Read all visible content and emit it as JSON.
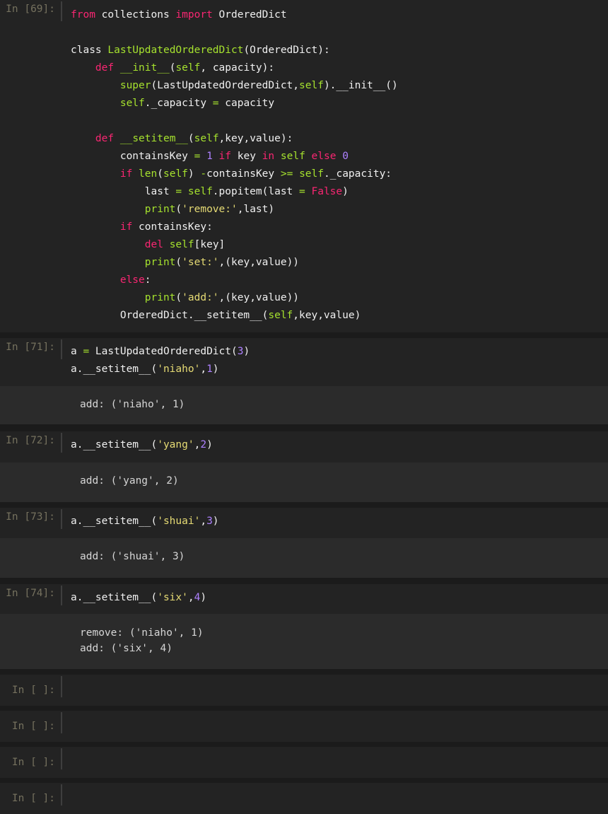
{
  "cells": [
    {
      "prompt": "In [69]:",
      "lines": [
        [
          [
            "kw",
            "from"
          ],
          [
            "plain",
            " collections "
          ],
          [
            "kw",
            "import"
          ],
          [
            "plain",
            " OrderedDict"
          ]
        ],
        [],
        [
          [
            "plain",
            "class "
          ],
          [
            "cls",
            "LastUpdatedOrderedDict"
          ],
          [
            "plain",
            "(OrderedDict):"
          ]
        ],
        [
          [
            "plain",
            "    "
          ],
          [
            "def",
            "def"
          ],
          [
            "plain",
            " "
          ],
          [
            "fn",
            "__init__"
          ],
          [
            "plain",
            "("
          ],
          [
            "self",
            "self"
          ],
          [
            "plain",
            ", capacity):"
          ]
        ],
        [
          [
            "plain",
            "        "
          ],
          [
            "self",
            "super"
          ],
          [
            "plain",
            "(LastUpdatedOrderedDict,"
          ],
          [
            "self",
            "self"
          ],
          [
            "plain",
            ").__init__()"
          ]
        ],
        [
          [
            "plain",
            "        "
          ],
          [
            "self",
            "self"
          ],
          [
            "plain",
            "._capacity "
          ],
          [
            "op",
            "="
          ],
          [
            "plain",
            " capacity"
          ]
        ],
        [],
        [
          [
            "plain",
            "    "
          ],
          [
            "def",
            "def"
          ],
          [
            "plain",
            " "
          ],
          [
            "fn",
            "__setitem__"
          ],
          [
            "plain",
            "("
          ],
          [
            "self",
            "self"
          ],
          [
            "plain",
            ",key,value):"
          ]
        ],
        [
          [
            "plain",
            "        containsKey "
          ],
          [
            "op",
            "="
          ],
          [
            "plain",
            " "
          ],
          [
            "num",
            "1"
          ],
          [
            "plain",
            " "
          ],
          [
            "kw",
            "if"
          ],
          [
            "plain",
            " key "
          ],
          [
            "kw",
            "in"
          ],
          [
            "plain",
            " "
          ],
          [
            "self",
            "self"
          ],
          [
            "plain",
            " "
          ],
          [
            "kw",
            "else"
          ],
          [
            "plain",
            " "
          ],
          [
            "num",
            "0"
          ]
        ],
        [
          [
            "plain",
            "        "
          ],
          [
            "kw",
            "if"
          ],
          [
            "plain",
            " "
          ],
          [
            "self",
            "len"
          ],
          [
            "plain",
            "("
          ],
          [
            "self",
            "self"
          ],
          [
            "plain",
            ") "
          ],
          [
            "op",
            "-"
          ],
          [
            "plain",
            "containsKey "
          ],
          [
            "op",
            ">="
          ],
          [
            "plain",
            " "
          ],
          [
            "self",
            "self"
          ],
          [
            "plain",
            "._capacity:"
          ]
        ],
        [
          [
            "plain",
            "            last "
          ],
          [
            "op",
            "="
          ],
          [
            "plain",
            " "
          ],
          [
            "self",
            "self"
          ],
          [
            "plain",
            ".popitem(last "
          ],
          [
            "op",
            "="
          ],
          [
            "plain",
            " "
          ],
          [
            "bool",
            "False"
          ],
          [
            "plain",
            ")"
          ]
        ],
        [
          [
            "plain",
            "            "
          ],
          [
            "self",
            "print"
          ],
          [
            "plain",
            "("
          ],
          [
            "str",
            "'remove:'"
          ],
          [
            "plain",
            ",last)"
          ]
        ],
        [
          [
            "plain",
            "        "
          ],
          [
            "kw",
            "if"
          ],
          [
            "plain",
            " containsKey:"
          ]
        ],
        [
          [
            "plain",
            "            "
          ],
          [
            "kw",
            "del"
          ],
          [
            "plain",
            " "
          ],
          [
            "self",
            "self"
          ],
          [
            "plain",
            "[key]"
          ]
        ],
        [
          [
            "plain",
            "            "
          ],
          [
            "self",
            "print"
          ],
          [
            "plain",
            "("
          ],
          [
            "str",
            "'set:'"
          ],
          [
            "plain",
            ",(key,value))"
          ]
        ],
        [
          [
            "plain",
            "        "
          ],
          [
            "kw",
            "else"
          ],
          [
            "plain",
            ":"
          ]
        ],
        [
          [
            "plain",
            "            "
          ],
          [
            "self",
            "print"
          ],
          [
            "plain",
            "("
          ],
          [
            "str",
            "'add:'"
          ],
          [
            "plain",
            ",(key,value))"
          ]
        ],
        [
          [
            "plain",
            "        OrderedDict.__setitem__("
          ],
          [
            "self",
            "self"
          ],
          [
            "plain",
            ",key,value)"
          ]
        ]
      ],
      "output": []
    },
    {
      "prompt": "In [71]:",
      "lines": [
        [
          [
            "plain",
            "a "
          ],
          [
            "op",
            "="
          ],
          [
            "plain",
            " LastUpdatedOrderedDict("
          ],
          [
            "num",
            "3"
          ],
          [
            "plain",
            ")"
          ]
        ],
        [
          [
            "plain",
            "a.__setitem__("
          ],
          [
            "str",
            "'niaho'"
          ],
          [
            "plain",
            ","
          ],
          [
            "num",
            "1"
          ],
          [
            "plain",
            ")"
          ]
        ]
      ],
      "output": [
        "add: ('niaho', 1)"
      ]
    },
    {
      "prompt": "In [72]:",
      "lines": [
        [
          [
            "plain",
            "a.__setitem__("
          ],
          [
            "str",
            "'yang'"
          ],
          [
            "plain",
            ","
          ],
          [
            "num",
            "2"
          ],
          [
            "plain",
            ")"
          ]
        ]
      ],
      "output": [
        "add: ('yang', 2)"
      ]
    },
    {
      "prompt": "In [73]:",
      "lines": [
        [
          [
            "plain",
            "a.__setitem__("
          ],
          [
            "str",
            "'shuai'"
          ],
          [
            "plain",
            ","
          ],
          [
            "num",
            "3"
          ],
          [
            "plain",
            ")"
          ]
        ]
      ],
      "output": [
        "add: ('shuai', 3)"
      ]
    },
    {
      "prompt": "In [74]:",
      "lines": [
        [
          [
            "plain",
            "a.__setitem__("
          ],
          [
            "str",
            "'six'"
          ],
          [
            "plain",
            ","
          ],
          [
            "num",
            "4"
          ],
          [
            "plain",
            ")"
          ]
        ]
      ],
      "output": [
        "remove: ('niaho', 1)",
        "add: ('six', 4)"
      ]
    },
    {
      "prompt": "In [ ]:",
      "lines": [],
      "output": []
    },
    {
      "prompt": "In [ ]:",
      "lines": [],
      "output": []
    },
    {
      "prompt": "In [ ]:",
      "lines": [],
      "output": []
    },
    {
      "prompt": "In [ ]:",
      "lines": [],
      "output": []
    }
  ],
  "colors": {
    "keyword": "#f92672",
    "builtin": "#a6e22e",
    "string": "#e6db74",
    "number": "#ae81ff",
    "prompt": "#75715e",
    "cell_bg": "#232323",
    "output_bg": "#2b2b2b",
    "page_bg": "#1b1b1b"
  }
}
